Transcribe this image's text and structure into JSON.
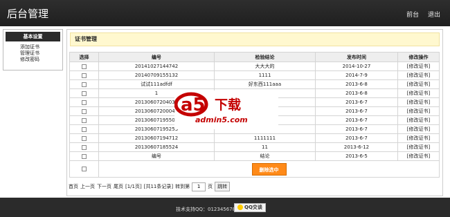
{
  "header": {
    "title": "后台管理",
    "nav": [
      "前台",
      "退出"
    ]
  },
  "sidebar": {
    "title": "基本设置",
    "items": [
      "添加证书",
      "管理证书",
      "修改密码"
    ]
  },
  "main": {
    "banner": "证书管理",
    "columns": [
      "选择",
      "编号",
      "检验结论",
      "发布时间",
      "修改操作"
    ],
    "rows": [
      [
        "20141027144742",
        "大大大的",
        "2014-10-27",
        "[修改证书]"
      ],
      [
        "20140709155132",
        "1111",
        "2014-7-9",
        "[修改证书]"
      ],
      [
        "试试111adfdf",
        "好东西111aaa",
        "2013-6-8",
        "[修改证书]"
      ],
      [
        "1",
        "",
        "2013-6-8",
        "[修改证书]"
      ],
      [
        "20130607204039",
        "",
        "2013-6-7",
        "[修改证书]"
      ],
      [
        "20130607200047",
        "",
        "2013-6-7",
        "[修改证书]"
      ],
      [
        "20130607195500",
        "",
        "2013-6-7",
        "[修改证书]"
      ],
      [
        "20130607195253",
        "",
        "2013-6-7",
        "[修改证书]"
      ],
      [
        "20130607194712",
        "1111111",
        "2013-6-7",
        "[修改证书]"
      ],
      [
        "20130607185524",
        "11",
        "2013-6-12",
        "[修改证书]"
      ],
      [
        "编号",
        "结论",
        "2013-6-5",
        "[修改证书]"
      ]
    ],
    "delete_label": "删除选中"
  },
  "pager": {
    "first": "首页",
    "prev": "上一页",
    "next": "下一页",
    "last": "尾页",
    "page_info": "[1/1页]",
    "total": "[共11条记录]",
    "goto_label": "转到第",
    "page_value": "1",
    "page_unit": "页",
    "go": "跳转"
  },
  "footer": {
    "support": "技术支持QQ：0123456789",
    "qq_button": "QQ交谈"
  },
  "watermark": {
    "logo": "a5",
    "text": "下载",
    "url": "admin5.com"
  }
}
